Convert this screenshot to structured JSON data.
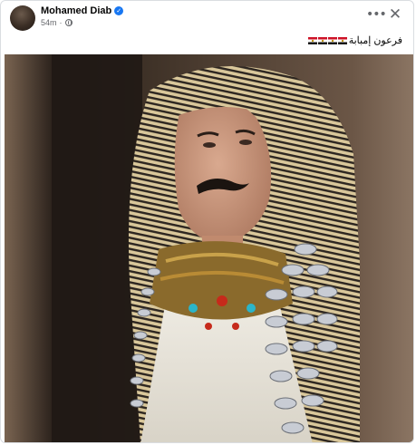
{
  "post": {
    "author": "Mohamed Diab",
    "timestamp": "54m",
    "caption_text": "فرعون إمبابة",
    "caption_flags": [
      "egypt-flag",
      "egypt-flag",
      "egypt-flag",
      "egypt-flag"
    ]
  },
  "header": {
    "more_label": "•••",
    "close_label": "✕",
    "verified_glyph": "✓"
  },
  "icons": {
    "verified": "verified-badge-icon",
    "audience": "globe-icon",
    "more": "more-options-icon",
    "close": "close-icon"
  },
  "colors": {
    "accent": "#1877f2",
    "text_primary": "#050505",
    "text_secondary": "#65676b"
  }
}
